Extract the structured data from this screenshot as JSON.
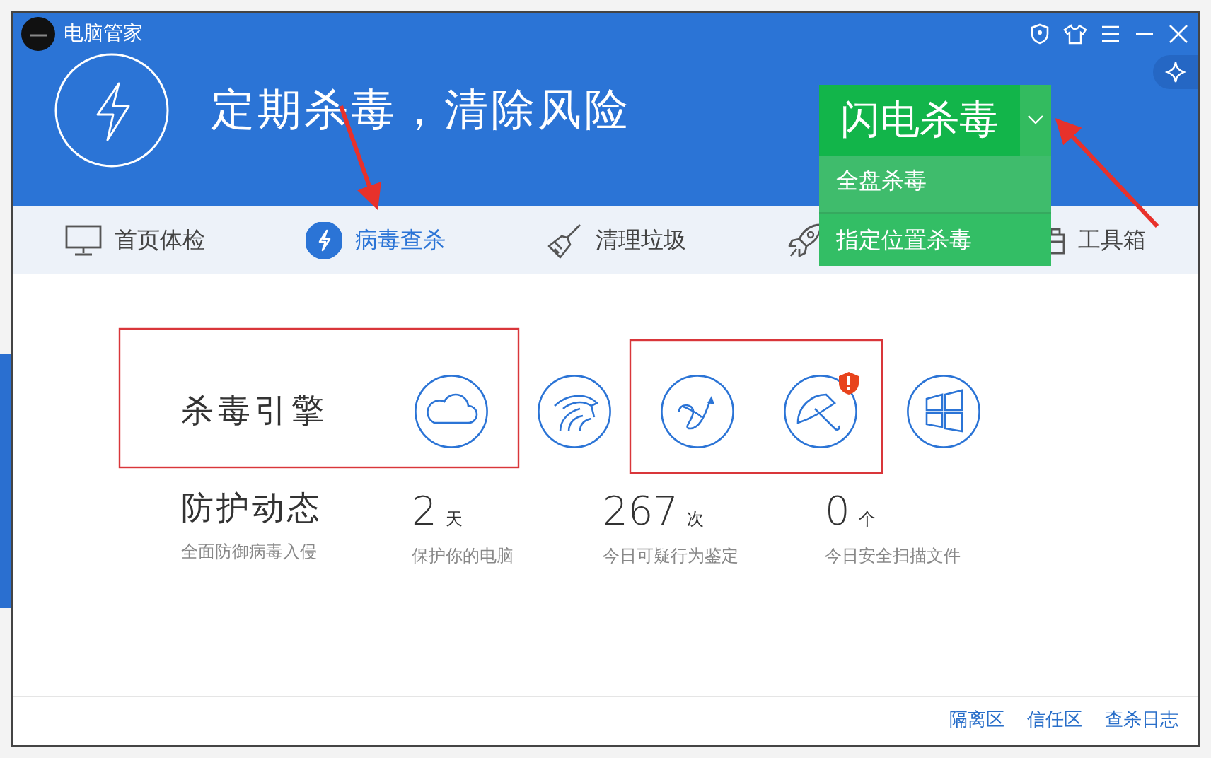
{
  "window": {
    "title": "电脑管家"
  },
  "header": {
    "slogan": "定期杀毒，清除风险"
  },
  "scan_button": {
    "label": "闪电杀毒",
    "expanded": true
  },
  "scan_menu": [
    {
      "label": "全盘杀毒"
    },
    {
      "label": "指定位置杀毒"
    }
  ],
  "nav_tabs": [
    {
      "kind": "monitor",
      "label": "首页体检",
      "selected": false
    },
    {
      "kind": "bolt",
      "label": "病毒查杀",
      "selected": true
    },
    {
      "kind": "broom",
      "label": "清理垃圾",
      "selected": false
    },
    {
      "kind": "rocket",
      "selected": false
    },
    {
      "kind": "toolbox",
      "label": "工具箱",
      "selected": false
    }
  ],
  "engine": {
    "title": "杀毒引擎",
    "engines": [
      {
        "kind": "cloud",
        "alert": false
      },
      {
        "kind": "eagle",
        "alert": false
      },
      {
        "kind": "route",
        "alert": false
      },
      {
        "kind": "umbrella",
        "alert": true
      },
      {
        "kind": "windows",
        "alert": false
      }
    ]
  },
  "protection": {
    "title": "防护动态",
    "subtitle": "全面防御病毒入侵",
    "stats": [
      {
        "value": "2",
        "unit": "天",
        "caption": "保护你的电脑"
      },
      {
        "value": "267",
        "unit": "次",
        "caption": "今日可疑行为鉴定"
      },
      {
        "value": "0",
        "unit": "个",
        "caption": "今日安全扫描文件"
      }
    ]
  },
  "footer_links": [
    "隔离区",
    "信任区",
    "查杀日志"
  ]
}
